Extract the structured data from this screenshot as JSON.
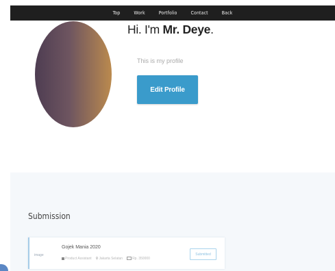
{
  "nav": {
    "items": [
      "Top",
      "Work",
      "Portfolio",
      "Contact",
      "Back"
    ]
  },
  "profile": {
    "greeting_prefix": "Hi. I'm ",
    "name": "Mr. Deye",
    "greeting_suffix": ".",
    "tagline": "This is my profile",
    "edit_button": "Edit Profile"
  },
  "submission": {
    "heading": "Submission",
    "items": [
      {
        "image_label": "image",
        "title": "Gojek Mania 2020",
        "role": "Product Assistant",
        "location": "Jakarta Selatan",
        "salary": "Rp. 350000",
        "status": "Submitted"
      }
    ]
  },
  "colors": {
    "nav_bg": "#1f1f1f",
    "accent": "#3a9bcb",
    "section_bg": "#f5f8fb"
  }
}
